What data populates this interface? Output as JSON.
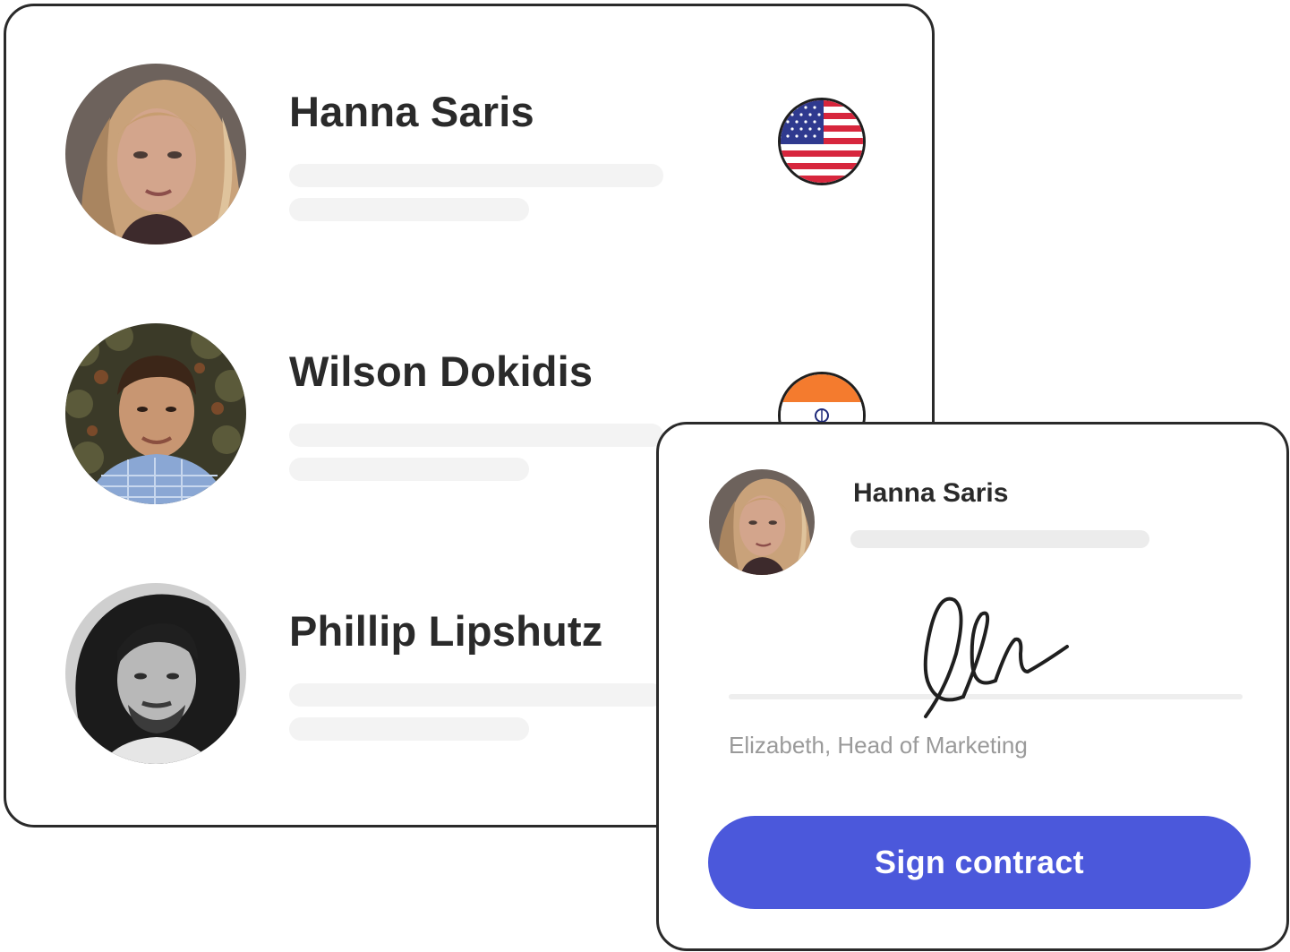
{
  "people": [
    {
      "name": "Hanna Saris",
      "avatar": "woman-avatar",
      "flag": "usa-flag-icon"
    },
    {
      "name": "Wilson Dokidis",
      "avatar": "man-avatar",
      "flag": "india-flag-icon"
    },
    {
      "name": "Phillip Lipshutz",
      "avatar": "man-bw-avatar",
      "flag": ""
    }
  ],
  "contract": {
    "name": "Hanna Saris",
    "signer": "Elizabeth, Head of Marketing",
    "button_label": "Sign contract",
    "signature_icon": "signature-icon"
  },
  "colors": {
    "accent": "#4b58db",
    "border": "#2a2a2a",
    "skeleton": "#f3f3f3",
    "muted_text": "#9a9a9a"
  }
}
